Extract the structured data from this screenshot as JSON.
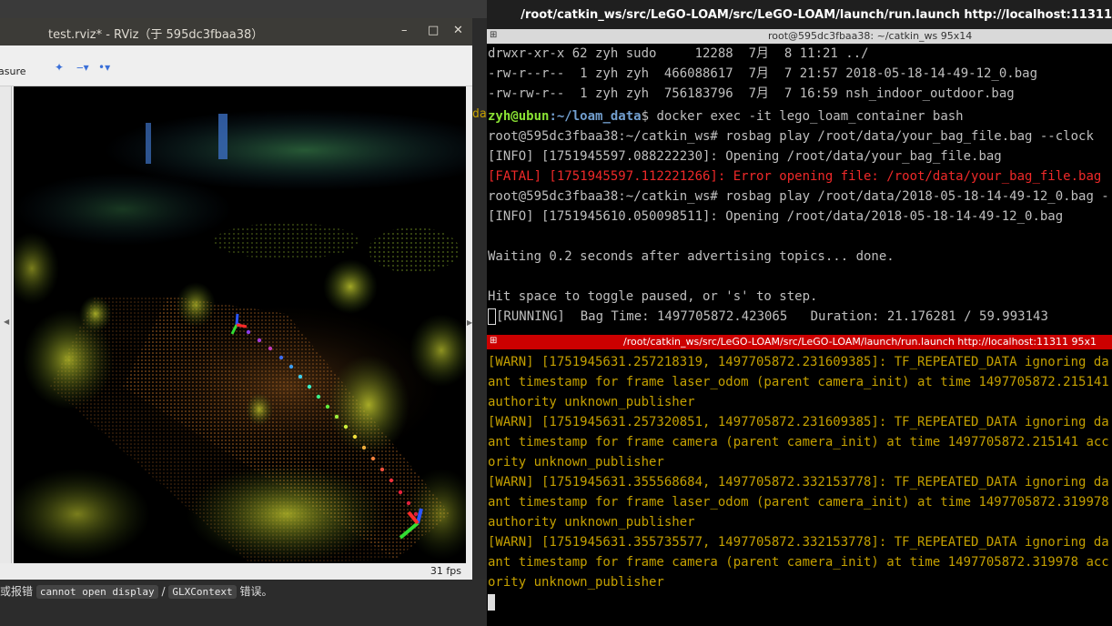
{
  "rviz": {
    "title": "test.rviz* - RViz（于 595dc3fbaa38）",
    "minimize": "–",
    "maximize": "□",
    "close": "✕",
    "toolbar_measure": "asure",
    "fps": "31 fps"
  },
  "note": {
    "prefix": "或报错",
    "code1": "cannot open display",
    "sep": "/",
    "code2": "GLXContext",
    "suffix": "错误。"
  },
  "terminal": {
    "outer_title": "/root/catkin_ws/src/LeGO-LOAM/src/LeGO-LOAM/launch/run.launch http://localhost:11311",
    "pane1_title": "root@595dc3fbaa38: ~/catkin_ws 95x14",
    "pane2_title": "/root/catkin_ws/src/LeGO-LOAM/src/LeGO-LOAM/launch/run.launch http://localhost:11311 95x1",
    "side_fragment": "da",
    "pane1_lines": {
      "l0": "drwxr-xr-x 62 zyh sudo     12288  7月  8 11:21 ../",
      "l1": "-rw-r--r--  1 zyh zyh  466088617  7月  7 21:57 2018-05-18-14-49-12_0.bag",
      "l2": "-rw-rw-r--  1 zyh zyh  756183796  7月  7 16:59 nsh_indoor_outdoor.bag",
      "l3_user": "zyh@ubun",
      "l3_path": ":~/loam_data",
      "l3_cmd": "$ docker exec -it lego_loam_container bash",
      "l4": "root@595dc3fbaa38:~/catkin_ws# rosbag play /root/data/your_bag_file.bag --clock",
      "l5": "[INFO] [1751945597.088222230]: Opening /root/data/your_bag_file.bag",
      "l6": "[FATAL] [1751945597.112221266]: Error opening file: /root/data/your_bag_file.bag",
      "l7": "root@595dc3fbaa38:~/catkin_ws# rosbag play /root/data/2018-05-18-14-49-12_0.bag -",
      "l8": "[INFO] [1751945610.050098511]: Opening /root/data/2018-05-18-14-49-12_0.bag",
      "l9": "Waiting 0.2 seconds after advertising topics... done.",
      "l10": "Hit space to toggle paused, or 's' to step.",
      "l11": "[RUNNING]  Bag Time: 1497705872.423065   Duration: 21.176281 / 59.993143"
    },
    "pane2_lines": {
      "l0": "[WARN] [1751945631.257218319, 1497705872.231609385]: TF_REPEATED_DATA ignoring da",
      "l1": "ant timestamp for frame laser_odom (parent camera_init) at time 1497705872.215141",
      "l2": "authority unknown_publisher",
      "l3": "[WARN] [1751945631.257320851, 1497705872.231609385]: TF_REPEATED_DATA ignoring da",
      "l4": "ant timestamp for frame camera (parent camera_init) at time 1497705872.215141 acc",
      "l5": "ority unknown_publisher",
      "l6": "[WARN] [1751945631.355568684, 1497705872.332153778]: TF_REPEATED_DATA ignoring da",
      "l7": "ant timestamp for frame laser_odom (parent camera_init) at time 1497705872.319978",
      "l8": "authority unknown_publisher",
      "l9": "[WARN] [1751945631.355735577, 1497705872.332153778]: TF_REPEATED_DATA ignoring da",
      "l10": "ant timestamp for frame camera (parent camera_init) at time 1497705872.319978 acc",
      "l11": "ority unknown_publisher"
    }
  }
}
